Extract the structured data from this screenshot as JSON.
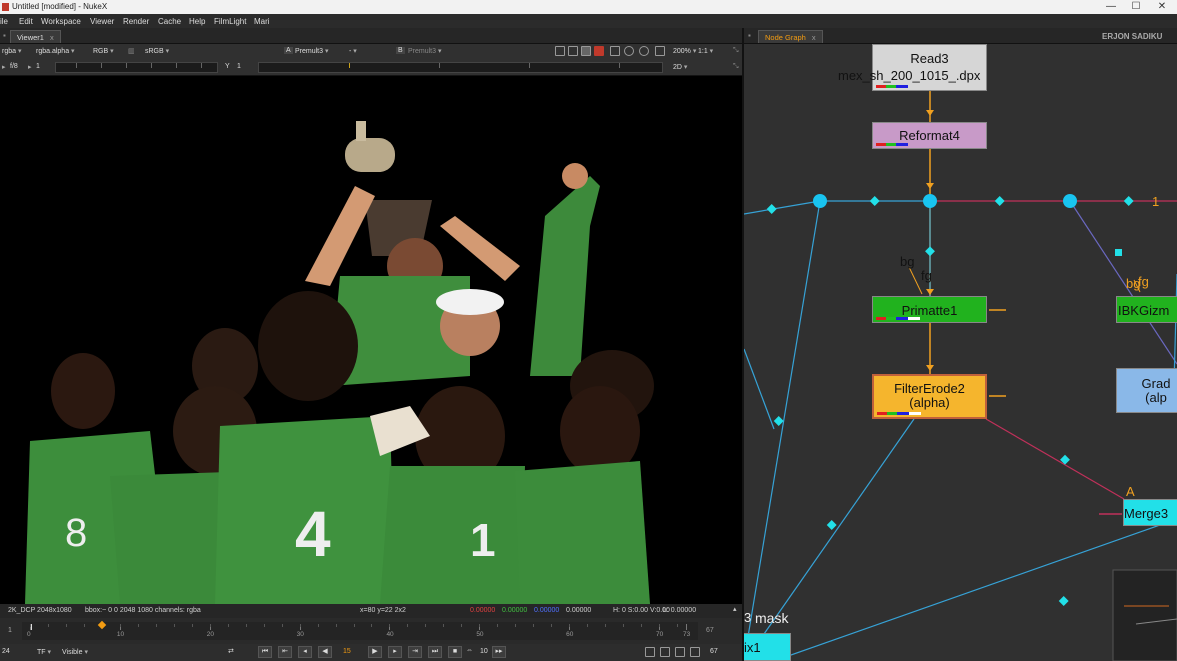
{
  "window": {
    "title": "Untitled [modified] - NukeX",
    "minimize": "—",
    "maximize": "☐",
    "close": "✕"
  },
  "menu": [
    "ile",
    "Edit",
    "Workspace",
    "Viewer",
    "Render",
    "Cache",
    "Help",
    "FilmLight",
    "Mari"
  ],
  "viewer_tab": {
    "label": "Viewer1",
    "close": "x"
  },
  "toolbar1": {
    "channels": "rgba",
    "alpha": "rgba.alpha",
    "display": "RGB",
    "lut": "sRGB",
    "a_label": "A",
    "a_input": "Premult3",
    "wipe": "-",
    "b_label": "B",
    "b_input": "Premult3",
    "zoom": "200%",
    "ratio": "1:1"
  },
  "toolbar2": {
    "fstop": "f/8",
    "frame": "1",
    "y_label": "Y",
    "y_value": "1",
    "view_mode": "2D"
  },
  "info_bar": {
    "format": "2K_DCP 2048x1080",
    "bbox": "bbox:~ 0 0 2048 1080 channels: rgba",
    "coords": "x=80 y=22 2x2",
    "r": "0.00000",
    "g": "0.00000",
    "b": "0.00000",
    "a": "0.00000",
    "hsv": "H: 0 S:0.00 V:0.00",
    "l": "L: 0.00000"
  },
  "timeline": {
    "start": "1",
    "end": "67",
    "ticks": [
      "0",
      "10",
      "20",
      "30",
      "40",
      "50",
      "60",
      "70",
      "73"
    ],
    "current_frame": 8
  },
  "playback": {
    "fps_mode": "TF",
    "visible": "Visible",
    "current": "15",
    "increment": "10",
    "end": "67",
    "left_frame": "24"
  },
  "node_graph_tab": {
    "label": "Node Graph",
    "close": "x"
  },
  "user": "ERJON SADIKU",
  "nodes": {
    "read": {
      "name": "Read3",
      "file": "mex_sh_200_1015_.dpx"
    },
    "reformat": {
      "name": "Reformat4"
    },
    "primatte": {
      "name": "Primatte1",
      "in_bg": "bg",
      "in_fg": "fg"
    },
    "filtererode": {
      "name": "FilterErode2",
      "sub": "(alpha)"
    },
    "ibkgizmo": {
      "name": "IBKGizm",
      "in_bg": "bg",
      "in_fg": "fg"
    },
    "grade": {
      "name": "Grad",
      "sub": "(alp"
    },
    "merge": {
      "name": "Merge3",
      "in_a": "A"
    },
    "mix": {
      "name": "ix1",
      "mask": "mask",
      "prefix": "3"
    },
    "num_label": "1"
  },
  "colors": {
    "read": "#d6d6d6",
    "reformat": "#c89ac8",
    "primatte": "#21b21e",
    "filtererode": "#f5b52d",
    "ibk": "#21b21e",
    "grade": "#8ab8e8",
    "merge": "#22e0e8",
    "pipe": "#36a2d6",
    "dot": "#19c4f0",
    "connector": "#f0a020"
  }
}
